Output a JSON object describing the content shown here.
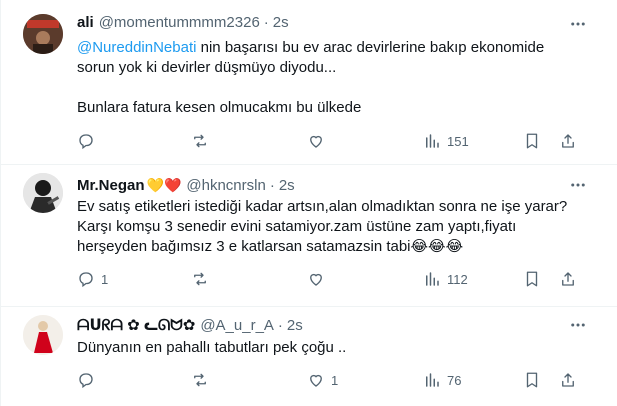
{
  "tweets": [
    {
      "name": "ali",
      "handle": "@momentummmm2326",
      "dot": "·",
      "time": "2s",
      "mention": "@NureddinNebati",
      "line1_rest": " nin başarısı bu ev arac devirlerine bakıp ekonomide",
      "line2": "sorun yok ki devirler düşmüyo diyodu...",
      "line3": "Bunlara fatura kesen olmucakmı bu ülkede",
      "reply_count": "",
      "repost_count": "",
      "like_count": "",
      "view_count": "151"
    },
    {
      "name": "Mr.Negan",
      "name_emojis": "💛❤️",
      "handle": "@hkncnrsln",
      "dot": "·",
      "time": "2s",
      "line1": "Ev satış etiketleri istediği kadar artsın,alan olmadıktan sonra ne işe yarar?",
      "line2": "Karşı komşu 3 senedir evini satamiyor.zam üstüne zam yaptı,fiyatı",
      "line3": "herşeyden bağımsız 3 e katlarsan satamazsin tabi",
      "line3_emojis": "😂😂😂",
      "reply_count": "1",
      "repost_count": "",
      "like_count": "",
      "view_count": "112"
    },
    {
      "name": "ᗩᑌᖇᗩ ✿ ᓚᘏᗢ✿",
      "handle": "@A_u_r_A",
      "dot": "·",
      "time": "2s",
      "line1": "Dünyanın en pahallı tabutları pek çoğu ..",
      "reply_count": "",
      "repost_count": "",
      "like_count": "1",
      "view_count": "76"
    }
  ],
  "colors": {
    "text": "#0f1419",
    "secondary": "#536471",
    "mention": "#1d9bf0",
    "divider": "#eff3f4"
  }
}
